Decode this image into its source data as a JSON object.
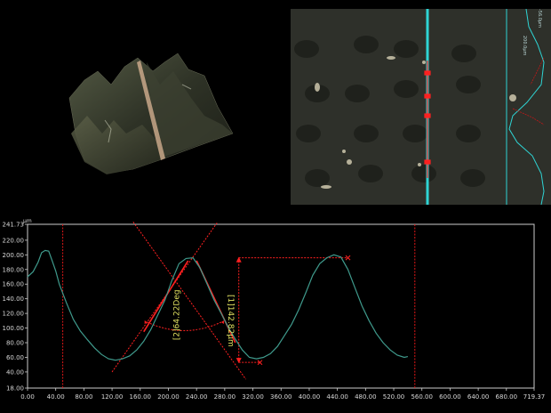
{
  "views": {
    "view3d_label": "",
    "micro_label": ""
  },
  "micro": {
    "right_scale_labels": [
      "200.0μm",
      "-56.0μm"
    ],
    "marker_labels": [
      "",
      "",
      "",
      ""
    ]
  },
  "chart_data": {
    "type": "line",
    "title": "",
    "xlabel": "",
    "ylabel": "",
    "y_unit": "μm",
    "xlim": [
      0.0,
      719.37
    ],
    "ylim": [
      18.0,
      241.73
    ],
    "x_ticks": [
      "0.00",
      "40.00",
      "80.00",
      "120.00",
      "160.00",
      "200.00",
      "240.00",
      "280.00",
      "320.00",
      "360.00",
      "400.00",
      "440.00",
      "480.00",
      "520.00",
      "560.00",
      "600.00",
      "640.00",
      "680.00",
      "719.37"
    ],
    "y_ticks": [
      "241.73",
      "220.00",
      "200.00",
      "180.00",
      "160.00",
      "140.00",
      "120.00",
      "100.00",
      "80.00",
      "60.00",
      "40.00",
      "18.00"
    ],
    "series": [
      {
        "name": "",
        "color": "#3f9a8c",
        "x": [
          0,
          8,
          15,
          20,
          25,
          30,
          35,
          40,
          45,
          55,
          65,
          75,
          85,
          95,
          105,
          115,
          125,
          135,
          145,
          155,
          165,
          175,
          185,
          195,
          205,
          215,
          225,
          235,
          245,
          255,
          265,
          275,
          285,
          295,
          305,
          315,
          325,
          335,
          345,
          355,
          365,
          375,
          385,
          395,
          405,
          415,
          425,
          435,
          445,
          455,
          465,
          475,
          485,
          495,
          505,
          515,
          525,
          535,
          540
        ],
        "y": [
          170,
          177,
          190,
          203,
          206,
          205,
          192,
          178,
          160,
          135,
          112,
          96,
          84,
          73,
          64,
          58,
          56,
          58,
          62,
          70,
          82,
          98,
          118,
          138,
          165,
          188,
          195,
          196,
          182,
          160,
          138,
          120,
          101,
          85,
          70,
          60,
          58,
          60,
          65,
          75,
          90,
          105,
          125,
          148,
          172,
          188,
          196,
          200,
          197,
          180,
          155,
          130,
          110,
          93,
          80,
          70,
          63,
          60,
          61
        ]
      }
    ],
    "grid": false,
    "vertical_markers_x": [
      50,
      550
    ],
    "angle_measurement": {
      "label": "[2]64.22Deg",
      "value_deg": 64.22
    },
    "height_measurement": {
      "label": "[1]142.82μm",
      "value_um": 142.82,
      "top_y": 196,
      "bottom_y": 53.18,
      "x": 300
    },
    "reference_points": [
      {
        "x": 455,
        "y": 196
      },
      {
        "x": 330,
        "y": 53
      }
    ]
  },
  "colors": {
    "background": "#000000",
    "plot_border": "#cccccc",
    "trace": "#3f9a8c",
    "measurement": "#ff2020",
    "annotation_text": "#e0e060",
    "scan_line": "#2fd4d4"
  }
}
